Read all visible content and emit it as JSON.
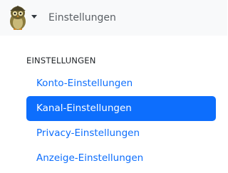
{
  "topbar": {
    "title": "Einstellungen",
    "avatar_icon": "owl-avatar-icon",
    "dropdown_icon": "caret-down-icon"
  },
  "sidebar": {
    "heading": "EINSTELLUNGEN",
    "items": [
      {
        "label": "Konto-Einstellungen",
        "active": false
      },
      {
        "label": "Kanal-Einstellungen",
        "active": true
      },
      {
        "label": "Privacy-Einstellungen",
        "active": false
      },
      {
        "label": "Anzeige-Einstellungen",
        "active": false
      }
    ]
  },
  "colors": {
    "accent": "#0d6efd",
    "topbar_bg": "#f8f9fa"
  }
}
